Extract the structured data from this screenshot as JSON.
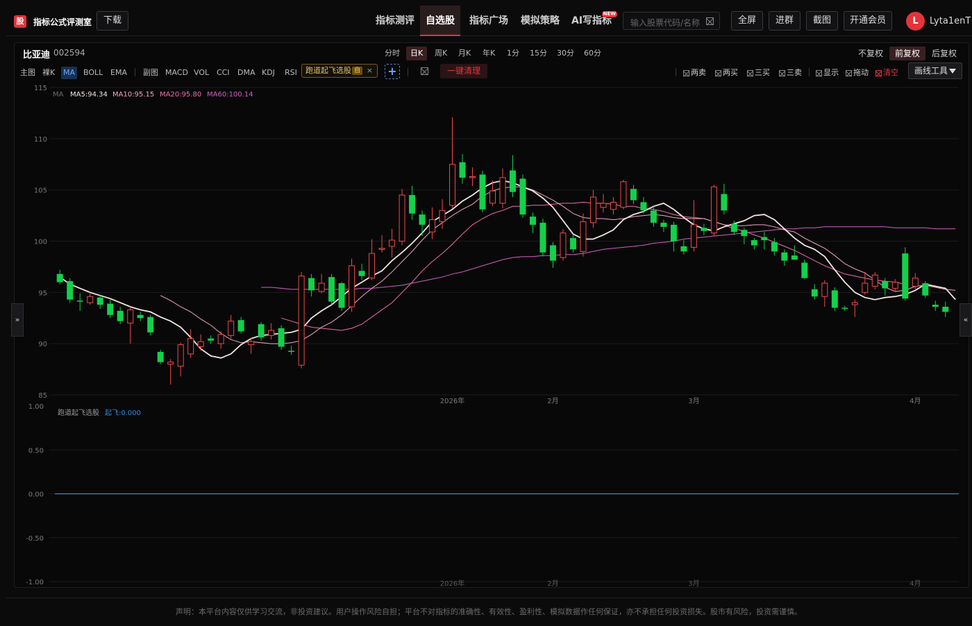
{
  "header": {
    "logo_char": "股",
    "app_title": "指标公式评测室",
    "download": "下载",
    "nav": [
      "指标测评",
      "自选股",
      "指标广场",
      "模拟策略",
      "AI写指标"
    ],
    "nav_new_badge": "NEW",
    "search_placeholder": "输入股票代码/名称",
    "buttons": [
      "全屏",
      "进群",
      "截图",
      "开通会员"
    ],
    "avatar_letter": "L",
    "username": "Lyta1enT"
  },
  "stock": {
    "name": "比亚迪",
    "code": "002594"
  },
  "periods": [
    "分时",
    "日K",
    "周K",
    "月K",
    "年K",
    "1分",
    "15分",
    "30分",
    "60分"
  ],
  "adjust": [
    "不复权",
    "前复权",
    "后复权"
  ],
  "indicators": {
    "main_label": "主图",
    "main": [
      "裸K",
      "MA",
      "BOLL",
      "EMA"
    ],
    "sub_label": "副图",
    "sub": [
      "MACD",
      "VOL",
      "CCI",
      "DMA",
      "KDJ",
      "RSI"
    ]
  },
  "chip": {
    "label": "跑道起飞选股",
    "tag": "自",
    "close": "×"
  },
  "add_button": "+",
  "clear_button": "一键清理",
  "tools": [
    "两卖",
    "两买",
    "三买",
    "三卖",
    "显示",
    "拖动",
    "清空"
  ],
  "draw_tools": "画线工具",
  "side_left": "»",
  "side_right": "«",
  "legend": {
    "ma": "MA",
    "ma5": "MA5:94.34",
    "ma10": "MA10:95.15",
    "ma20": "MA20:95.80",
    "ma60": "MA60:100.14"
  },
  "sub_legend": {
    "name": "跑道起飞选股",
    "value": "起飞:0.000"
  },
  "footer": "声明：本平台内容仅供学习交流，非投资建议。用户操作风险自担；平台不对指标的准确性、有效性、盈利性、模拟数据作任何保证，亦不承担任何投资损失。股市有风险，投资需谨慎。",
  "colors": {
    "up": "#f04a4a",
    "down": "#14d04a",
    "accent": "#e5333a",
    "ma5": "#f3e6e0",
    "ma10": "#f2a7bf",
    "ma20": "#ef6fa9",
    "ma60": "#d45fbf",
    "sub_line": "#2f8ae0"
  },
  "chart_data": [
    {
      "type": "candlestick",
      "ylim": [
        85,
        115
      ],
      "yticks": [
        "115",
        "110",
        "105",
        "100",
        "95",
        "90",
        "85"
      ],
      "xticks": [
        "2026年",
        "2月",
        "3月",
        "4月"
      ],
      "xtick_index": [
        39,
        49,
        63,
        85
      ],
      "candles": [
        [
          96.8,
          96.0,
          97.2,
          95.8
        ],
        [
          96.1,
          94.3,
          96.4,
          94.0
        ],
        [
          94.2,
          94.1,
          94.9,
          93.2
        ],
        [
          94.0,
          94.6,
          94.9,
          93.8
        ],
        [
          94.5,
          93.8,
          94.7,
          93.4
        ],
        [
          93.9,
          92.8,
          94.3,
          92.5
        ],
        [
          93.2,
          92.2,
          93.6,
          91.9
        ],
        [
          92.0,
          93.3,
          93.6,
          90.0
        ],
        [
          92.8,
          92.5,
          93.1,
          92.2
        ],
        [
          92.6,
          91.1,
          92.8,
          90.8
        ],
        [
          89.2,
          88.2,
          89.4,
          88.0
        ],
        [
          88.0,
          88.2,
          88.5,
          86.0
        ],
        [
          87.8,
          89.9,
          90.1,
          86.8
        ],
        [
          89.0,
          90.5,
          91.4,
          88.6
        ],
        [
          89.7,
          90.2,
          90.9,
          89.3
        ],
        [
          90.5,
          90.3,
          90.8,
          90.0
        ],
        [
          90.0,
          90.9,
          91.2,
          89.5
        ],
        [
          90.8,
          92.2,
          92.8,
          90.5
        ],
        [
          92.3,
          91.2,
          92.6,
          91.0
        ],
        [
          89.9,
          90.2,
          90.6,
          89.0
        ],
        [
          91.9,
          90.6,
          92.1,
          90.3
        ],
        [
          90.8,
          91.3,
          92.0,
          90.4
        ],
        [
          91.5,
          89.7,
          91.8,
          89.4
        ],
        [
          89.3,
          89.2,
          89.8,
          88.9
        ],
        [
          87.9,
          96.6,
          97.0,
          87.6
        ],
        [
          96.4,
          95.2,
          96.8,
          94.6
        ],
        [
          95.1,
          95.9,
          96.8,
          94.9
        ],
        [
          96.5,
          94.1,
          96.8,
          93.8
        ],
        [
          95.9,
          93.5,
          96.0,
          93.2
        ],
        [
          93.6,
          97.6,
          98.3,
          93.1
        ],
        [
          97.1,
          96.6,
          97.8,
          96.2
        ],
        [
          96.4,
          98.8,
          100.2,
          96.2
        ],
        [
          99.2,
          99.3,
          100.6,
          98.9
        ],
        [
          99.5,
          100.1,
          101.2,
          98.4
        ],
        [
          100.0,
          104.5,
          105.1,
          99.6
        ],
        [
          104.5,
          102.7,
          105.4,
          102.1
        ],
        [
          102.6,
          101.6,
          103.0,
          100.5
        ],
        [
          100.9,
          102.1,
          103.3,
          100.2
        ],
        [
          101.9,
          103.0,
          104.1,
          101.2
        ],
        [
          103.5,
          107.5,
          112.1,
          103.2
        ],
        [
          107.7,
          106.2,
          108.5,
          105.6
        ],
        [
          106.2,
          106.3,
          107.2,
          105.4
        ],
        [
          106.5,
          103.1,
          106.9,
          102.8
        ],
        [
          103.7,
          104.9,
          105.9,
          103.4
        ],
        [
          103.7,
          106.2,
          107.1,
          103.2
        ],
        [
          106.9,
          104.8,
          108.4,
          104.3
        ],
        [
          106.1,
          102.6,
          106.5,
          102.3
        ],
        [
          102.4,
          101.6,
          102.8,
          100.8
        ],
        [
          101.8,
          98.9,
          102.2,
          98.5
        ],
        [
          99.6,
          98.1,
          99.9,
          97.4
        ],
        [
          98.4,
          100.8,
          101.2,
          98.1
        ],
        [
          100.3,
          99.2,
          100.6,
          98.9
        ],
        [
          99.0,
          101.9,
          102.7,
          98.5
        ],
        [
          101.8,
          104.3,
          105.0,
          101.3
        ],
        [
          103.3,
          103.7,
          104.6,
          102.8
        ],
        [
          103.1,
          103.8,
          104.3,
          102.6
        ],
        [
          103.3,
          105.8,
          106.0,
          103.1
        ],
        [
          105.1,
          104.0,
          105.5,
          103.6
        ],
        [
          103.8,
          103.0,
          104.3,
          102.7
        ],
        [
          103.0,
          101.8,
          103.4,
          101.4
        ],
        [
          101.8,
          101.4,
          102.1,
          100.9
        ],
        [
          101.6,
          100.0,
          101.9,
          99.0
        ],
        [
          99.5,
          99.0,
          100.1,
          98.7
        ],
        [
          99.4,
          101.6,
          104.0,
          99.0
        ],
        [
          101.3,
          101.0,
          101.7,
          100.6
        ],
        [
          100.8,
          105.3,
          105.5,
          100.5
        ],
        [
          104.6,
          103.0,
          105.6,
          102.6
        ],
        [
          101.7,
          100.9,
          102.0,
          100.6
        ],
        [
          101.1,
          100.5,
          101.3,
          99.7
        ],
        [
          100.1,
          99.6,
          100.3,
          99.2
        ],
        [
          100.4,
          100.1,
          100.9,
          99.2
        ],
        [
          99.9,
          99.0,
          100.3,
          98.6
        ],
        [
          98.9,
          98.1,
          99.2,
          97.6
        ],
        [
          98.6,
          98.2,
          99.6,
          98.2
        ],
        [
          97.9,
          96.4,
          98.2,
          96.3
        ],
        [
          95.3,
          94.6,
          95.8,
          94.3
        ],
        [
          94.6,
          95.9,
          96.2,
          93.6
        ],
        [
          95.2,
          93.5,
          95.5,
          93.2
        ],
        [
          93.5,
          93.4,
          93.7,
          93.2
        ],
        [
          93.8,
          94.0,
          94.3,
          92.6
        ],
        [
          95.0,
          95.9,
          97.0,
          94.8
        ],
        [
          95.6,
          96.7,
          97.0,
          95.3
        ],
        [
          96.1,
          95.4,
          96.4,
          94.7
        ],
        [
          95.4,
          96.0,
          96.3,
          95.1
        ],
        [
          98.8,
          94.4,
          99.4,
          94.2
        ],
        [
          95.6,
          96.4,
          96.9,
          95.3
        ],
        [
          95.9,
          94.7,
          96.1,
          94.5
        ],
        [
          93.8,
          93.6,
          94.2,
          93.2
        ],
        [
          93.6,
          93.1,
          94.1,
          92.6
        ]
      ],
      "ma5": [
        96.5,
        95.8,
        95.4,
        95.0,
        94.7,
        94.4,
        94.0,
        93.6,
        93.3,
        93.1,
        92.6,
        92.2,
        91.6,
        90.6,
        89.5,
        88.8,
        88.6,
        89.0,
        89.9,
        90.5,
        90.8,
        90.9,
        91.0,
        91.1,
        91.4,
        92.5,
        93.2,
        93.8,
        94.6,
        95.4,
        96.0,
        96.6,
        97.1,
        98.1,
        98.9,
        99.8,
        100.8,
        101.9,
        102.5,
        103.1,
        103.9,
        104.5,
        105.2,
        105.7,
        105.9,
        105.7,
        105.3,
        104.9,
        104.2,
        103.3,
        102.0,
        100.7,
        100.2,
        100.2,
        100.6,
        101.1,
        102.1,
        102.6,
        102.9,
        103.4,
        103.7,
        103.1,
        102.3,
        101.6,
        101.2,
        101.0,
        101.4,
        101.7,
        102.0,
        102.5,
        102.6,
        102.1,
        101.2,
        100.3,
        99.6,
        99.2,
        98.5,
        97.2,
        96.0,
        95.0,
        94.5,
        94.3,
        94.5,
        94.6,
        94.8,
        95.2,
        95.8,
        95.6,
        95.4,
        94.3
      ],
      "ma10": [
        null,
        null,
        null,
        null,
        null,
        null,
        null,
        null,
        null,
        null,
        94.7,
        94.2,
        93.6,
        93.1,
        92.4,
        91.8,
        91.0,
        90.4,
        90.1,
        90.2,
        90.1,
        90.0,
        90.0,
        90.1,
        90.3,
        90.9,
        91.6,
        92.1,
        92.8,
        93.7,
        94.6,
        95.4,
        96.1,
        97.0,
        98.0,
        99.0,
        100.1,
        101.1,
        101.8,
        102.5,
        103.1,
        103.6,
        104.4,
        104.9,
        105.2,
        105.3,
        105.3,
        105.0,
        104.5,
        104.0,
        103.4,
        102.7,
        102.3,
        102.2,
        102.2,
        102.1,
        102.2,
        102.4,
        102.5,
        102.6,
        102.5,
        102.3,
        102.2,
        102.2,
        102.2,
        101.9,
        101.6,
        101.5,
        101.5,
        101.6,
        101.6,
        101.4,
        101.1,
        100.9,
        100.3,
        99.8,
        99.3,
        98.6,
        97.8,
        97.3,
        96.9,
        96.2,
        95.5,
        95.1,
        95.2,
        95.6,
        95.7,
        95.5,
        95.3,
        95.2
      ],
      "ma20": [
        null,
        null,
        null,
        null,
        null,
        null,
        null,
        null,
        null,
        null,
        null,
        null,
        null,
        null,
        null,
        null,
        null,
        null,
        null,
        null,
        null,
        null,
        92.5,
        92.2,
        91.9,
        91.6,
        91.5,
        91.4,
        91.3,
        91.5,
        91.9,
        92.6,
        93.3,
        94.0,
        95.0,
        96.0,
        97.1,
        98.0,
        98.8,
        99.7,
        100.7,
        101.6,
        102.2,
        102.7,
        103.0,
        103.4,
        103.4,
        103.5,
        103.5,
        103.6,
        103.7,
        103.7,
        103.8,
        103.7,
        103.7,
        103.6,
        103.4,
        103.4,
        103.2,
        103.1,
        102.9,
        102.6,
        102.4,
        102.3,
        102.2,
        101.9,
        101.6,
        101.2,
        101.0,
        100.6,
        100.3,
        99.9,
        99.5,
        99.1,
        98.6,
        98.1,
        97.6,
        97.2,
        96.8,
        96.6,
        96.4,
        96.2,
        96.1,
        96.0,
        95.8
      ],
      "ma60": [
        null,
        null,
        null,
        null,
        null,
        null,
        null,
        null,
        null,
        null,
        null,
        null,
        null,
        null,
        null,
        null,
        null,
        null,
        null,
        null,
        95.5,
        95.5,
        95.4,
        95.3,
        95.3,
        95.3,
        95.3,
        95.3,
        95.3,
        95.3,
        95.4,
        95.4,
        95.5,
        95.6,
        95.7,
        95.9,
        96.1,
        96.3,
        96.5,
        96.8,
        97.0,
        97.3,
        97.6,
        97.9,
        98.2,
        98.4,
        98.5,
        98.5,
        98.6,
        98.6,
        98.7,
        98.7,
        98.8,
        99.0,
        99.2,
        99.3,
        99.4,
        99.5,
        99.6,
        99.8,
        99.9,
        100.0,
        100.2,
        100.3,
        100.4,
        100.5,
        100.6,
        100.7,
        100.8,
        100.9,
        101.0,
        101.1,
        101.2,
        101.2,
        101.3,
        101.3,
        101.4,
        101.4,
        101.4,
        101.4,
        101.4,
        101.4,
        101.4,
        101.3,
        101.3,
        101.3,
        101.3,
        101.2,
        101.2,
        101.2
      ]
    },
    {
      "type": "line",
      "series": [
        {
          "name": "起飞",
          "values": [
            0
          ]
        }
      ],
      "ylim": [
        -1,
        1
      ],
      "yticks": [
        "1.00",
        "0.50",
        "0.00",
        "-0.50",
        "-1.00"
      ],
      "xticks": [
        "2026年",
        "2月",
        "3月",
        "4月"
      ]
    }
  ]
}
